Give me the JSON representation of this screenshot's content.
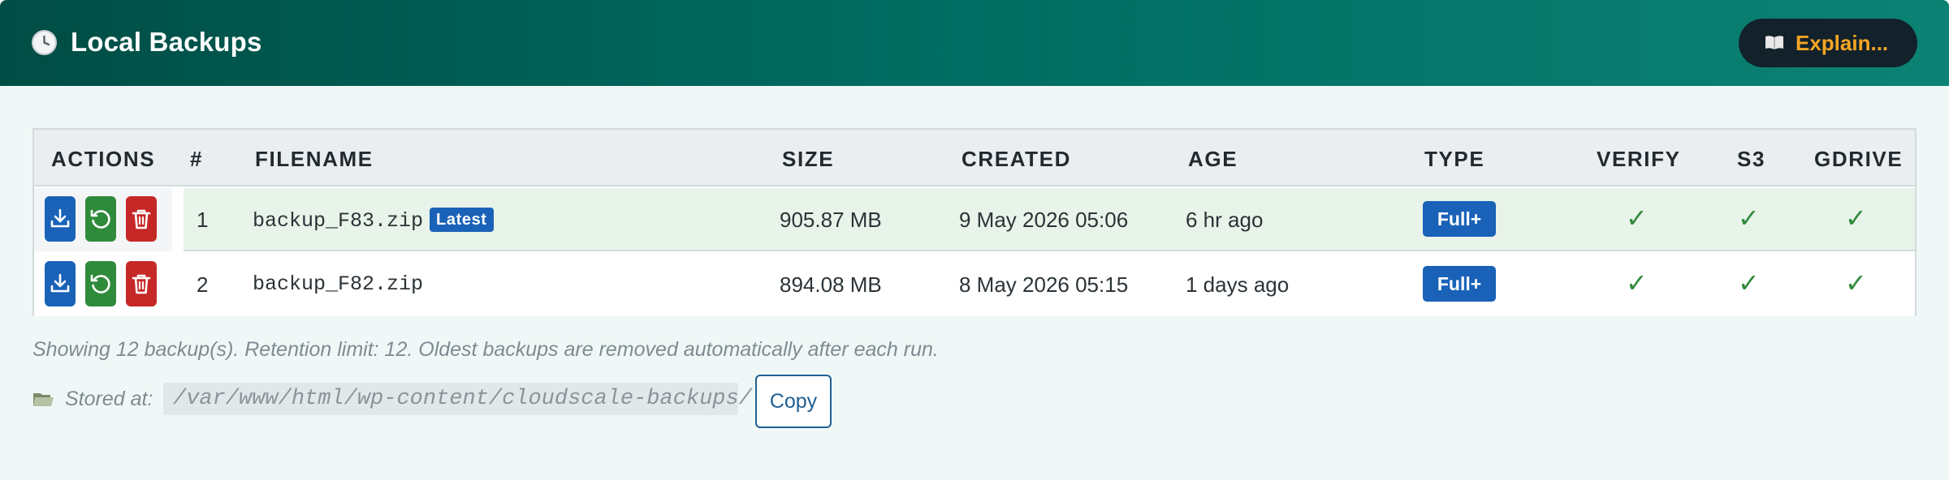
{
  "header": {
    "title": "Local Backups",
    "icon": "clock-icon",
    "explain_label": "Explain..."
  },
  "table": {
    "columns": [
      "ACTIONS",
      "#",
      "FILENAME",
      "SIZE",
      "CREATED",
      "AGE",
      "TYPE",
      "VERIFY",
      "S3",
      "GDRIVE"
    ],
    "rows": [
      {
        "num": "1",
        "filename": "backup_F83.zip",
        "badge": "Latest",
        "size": "905.87 MB",
        "created": "9 May 2026 05:06",
        "age": "6 hr ago",
        "type": "Full+",
        "verify": "✓",
        "s3": "✓",
        "gdrive": "✓",
        "highlighted": true
      },
      {
        "num": "2",
        "filename": "backup_F82.zip",
        "size": "894.08 MB",
        "created": "8 May 2026 05:15",
        "age": "1 days ago",
        "type": "Full+",
        "verify": "✓",
        "s3": "✓",
        "gdrive": "✓",
        "highlighted": false
      }
    ],
    "action_icons": [
      "download-icon",
      "restore-icon",
      "trash-icon"
    ]
  },
  "footer": {
    "note": "Showing 12 backup(s). Retention limit: 12. Oldest backups are removed automatically after each run.",
    "stored_label": "Stored at:",
    "stored_path": "/var/www/html/wp-content/cloudscale-backups/",
    "copy_label": "Copy"
  },
  "colors": {
    "header_start": "#004d45",
    "header_end": "#0b8274",
    "accent_orange": "#f5a623",
    "primary_blue": "#1a62b8",
    "success_green": "#2f8b3c",
    "danger_red": "#c62828"
  }
}
